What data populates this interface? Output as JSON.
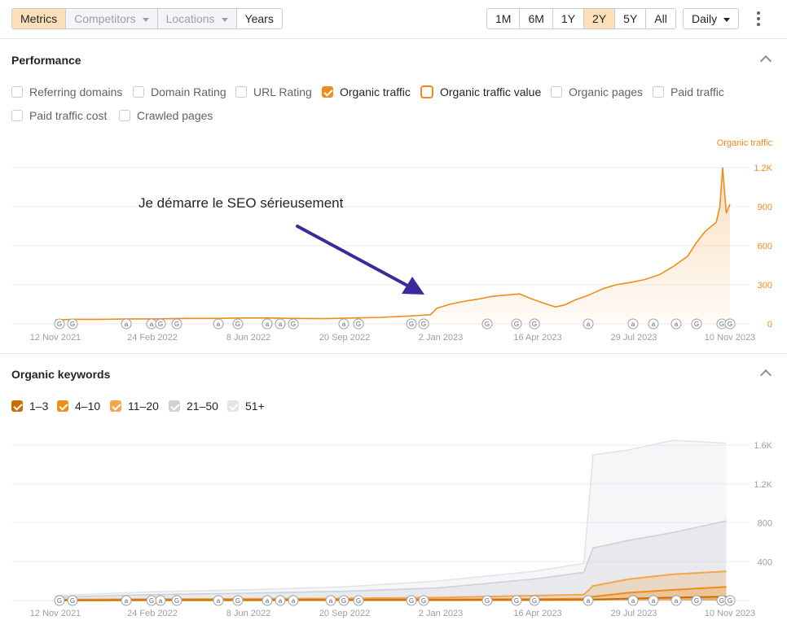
{
  "toolbar": {
    "tabs": [
      "Metrics",
      "Competitors",
      "Locations",
      "Years"
    ],
    "ranges": [
      "1M",
      "6M",
      "1Y",
      "2Y",
      "5Y",
      "All"
    ],
    "active_range": "2Y",
    "interval": "Daily"
  },
  "performance": {
    "title": "Performance",
    "checkboxes": [
      {
        "label": "Referring domains",
        "state": "off"
      },
      {
        "label": "Domain Rating",
        "state": "off"
      },
      {
        "label": "URL Rating",
        "state": "off"
      },
      {
        "label": "Organic traffic",
        "state": "on"
      },
      {
        "label": "Organic traffic value",
        "state": "ring"
      },
      {
        "label": "Organic pages",
        "state": "off"
      },
      {
        "label": "Paid traffic",
        "state": "off"
      },
      {
        "label": "Paid traffic cost",
        "state": "off"
      },
      {
        "label": "Crawled pages",
        "state": "off"
      }
    ],
    "annotation": "Je démarre le SEO sérieusement"
  },
  "organic_keywords": {
    "title": "Organic keywords",
    "checkboxes": [
      {
        "label": "1–3",
        "state": "on",
        "color": "#c96e05"
      },
      {
        "label": "4–10",
        "state": "on",
        "color": "#f08c1a"
      },
      {
        "label": "11–20",
        "state": "on",
        "color": "#f5a54a"
      },
      {
        "label": "21–50",
        "state": "on",
        "color": "#cdd2d8"
      },
      {
        "label": "51+",
        "state": "on",
        "color": "#e1e4e8"
      }
    ]
  },
  "colors": {
    "accent": "#f08c1a",
    "arrow": "#3b2a9c",
    "grid": "#eceef0",
    "axis_text": "#9aa0a6"
  },
  "chart_data": [
    {
      "type": "area",
      "series": [
        {
          "name": "Organic traffic",
          "color": "#f08c1a",
          "x": [
            "2021-11-12",
            "2021-12-01",
            "2022-01-01",
            "2022-02-01",
            "2022-03-01",
            "2022-04-01",
            "2022-05-01",
            "2022-06-01",
            "2022-07-01",
            "2022-08-01",
            "2022-09-01",
            "2022-10-01",
            "2022-11-01",
            "2022-12-01",
            "2022-12-25",
            "2023-01-01",
            "2023-01-15",
            "2023-02-01",
            "2023-02-15",
            "2023-03-01",
            "2023-03-15",
            "2023-04-01",
            "2023-04-15",
            "2023-05-01",
            "2023-05-10",
            "2023-05-20",
            "2023-06-01",
            "2023-06-15",
            "2023-07-01",
            "2023-07-15",
            "2023-08-01",
            "2023-08-15",
            "2023-09-01",
            "2023-09-15",
            "2023-10-01",
            "2023-10-10",
            "2023-10-20",
            "2023-11-01",
            "2023-11-05",
            "2023-11-08",
            "2023-11-12",
            "2023-11-16"
          ],
          "values": [
            30,
            35,
            35,
            38,
            38,
            42,
            42,
            45,
            45,
            42,
            40,
            45,
            50,
            60,
            70,
            120,
            150,
            175,
            190,
            210,
            220,
            230,
            190,
            150,
            130,
            145,
            185,
            220,
            270,
            300,
            320,
            340,
            380,
            440,
            520,
            620,
            710,
            780,
            900,
            1200,
            850,
            920
          ]
        }
      ],
      "x_ticks": [
        "12 Nov 2021",
        "24 Feb 2022",
        "8 Jun 2022",
        "20 Sep 2022",
        "2 Jan 2023",
        "16 Apr 2023",
        "29 Jul 2023",
        "10 Nov 2023"
      ],
      "y_ticks": [
        "0",
        "300",
        "600",
        "900",
        "1.2K"
      ],
      "ylabel": "Organic traffic",
      "ylim": [
        0,
        1200
      ]
    },
    {
      "type": "area",
      "series": [
        {
          "name": "51+",
          "color": "#e1e4e8",
          "x": [
            "2021-11-12",
            "2022-02-24",
            "2022-06-08",
            "2022-09-20",
            "2023-01-02",
            "2023-04-16",
            "2023-06-10",
            "2023-06-20",
            "2023-07-29",
            "2023-09-15",
            "2023-11-12"
          ],
          "values": [
            50,
            90,
            110,
            140,
            200,
            300,
            380,
            1500,
            1550,
            1650,
            1620
          ]
        },
        {
          "name": "21–50",
          "color": "#cdd2d8",
          "x": [
            "2021-11-12",
            "2022-02-24",
            "2022-06-08",
            "2022-09-20",
            "2023-01-02",
            "2023-04-16",
            "2023-06-10",
            "2023-06-20",
            "2023-07-29",
            "2023-09-15",
            "2023-11-12"
          ],
          "values": [
            35,
            60,
            75,
            95,
            130,
            220,
            290,
            540,
            620,
            700,
            820
          ]
        },
        {
          "name": "11–20",
          "color": "#f5a54a",
          "x": [
            "2021-11-12",
            "2022-02-24",
            "2022-06-08",
            "2022-09-20",
            "2023-01-02",
            "2023-04-16",
            "2023-06-10",
            "2023-06-20",
            "2023-07-29",
            "2023-09-15",
            "2023-11-12"
          ],
          "values": [
            10,
            15,
            18,
            22,
            30,
            50,
            60,
            150,
            220,
            270,
            300
          ]
        },
        {
          "name": "4–10",
          "color": "#f08c1a",
          "x": [
            "2021-11-12",
            "2022-02-24",
            "2022-06-08",
            "2022-09-20",
            "2023-01-02",
            "2023-04-16",
            "2023-06-10",
            "2023-06-20",
            "2023-07-29",
            "2023-09-15",
            "2023-11-12"
          ],
          "values": [
            5,
            8,
            9,
            10,
            12,
            15,
            20,
            40,
            80,
            110,
            140
          ]
        },
        {
          "name": "1–3",
          "color": "#c96e05",
          "x": [
            "2021-11-12",
            "2022-02-24",
            "2022-06-08",
            "2022-09-20",
            "2023-01-02",
            "2023-04-16",
            "2023-06-10",
            "2023-06-20",
            "2023-07-29",
            "2023-09-15",
            "2023-11-12"
          ],
          "values": [
            2,
            3,
            3,
            4,
            4,
            5,
            6,
            10,
            20,
            30,
            40
          ]
        }
      ],
      "x_ticks": [
        "12 Nov 2021",
        "24 Feb 2022",
        "8 Jun 2022",
        "20 Sep 2022",
        "2 Jan 2023",
        "16 Apr 2023",
        "29 Jul 2023",
        "10 Nov 2023"
      ],
      "y_ticks": [
        "400",
        "800",
        "1.2K",
        "1.6K"
      ],
      "ylim": [
        0,
        1600
      ]
    }
  ]
}
